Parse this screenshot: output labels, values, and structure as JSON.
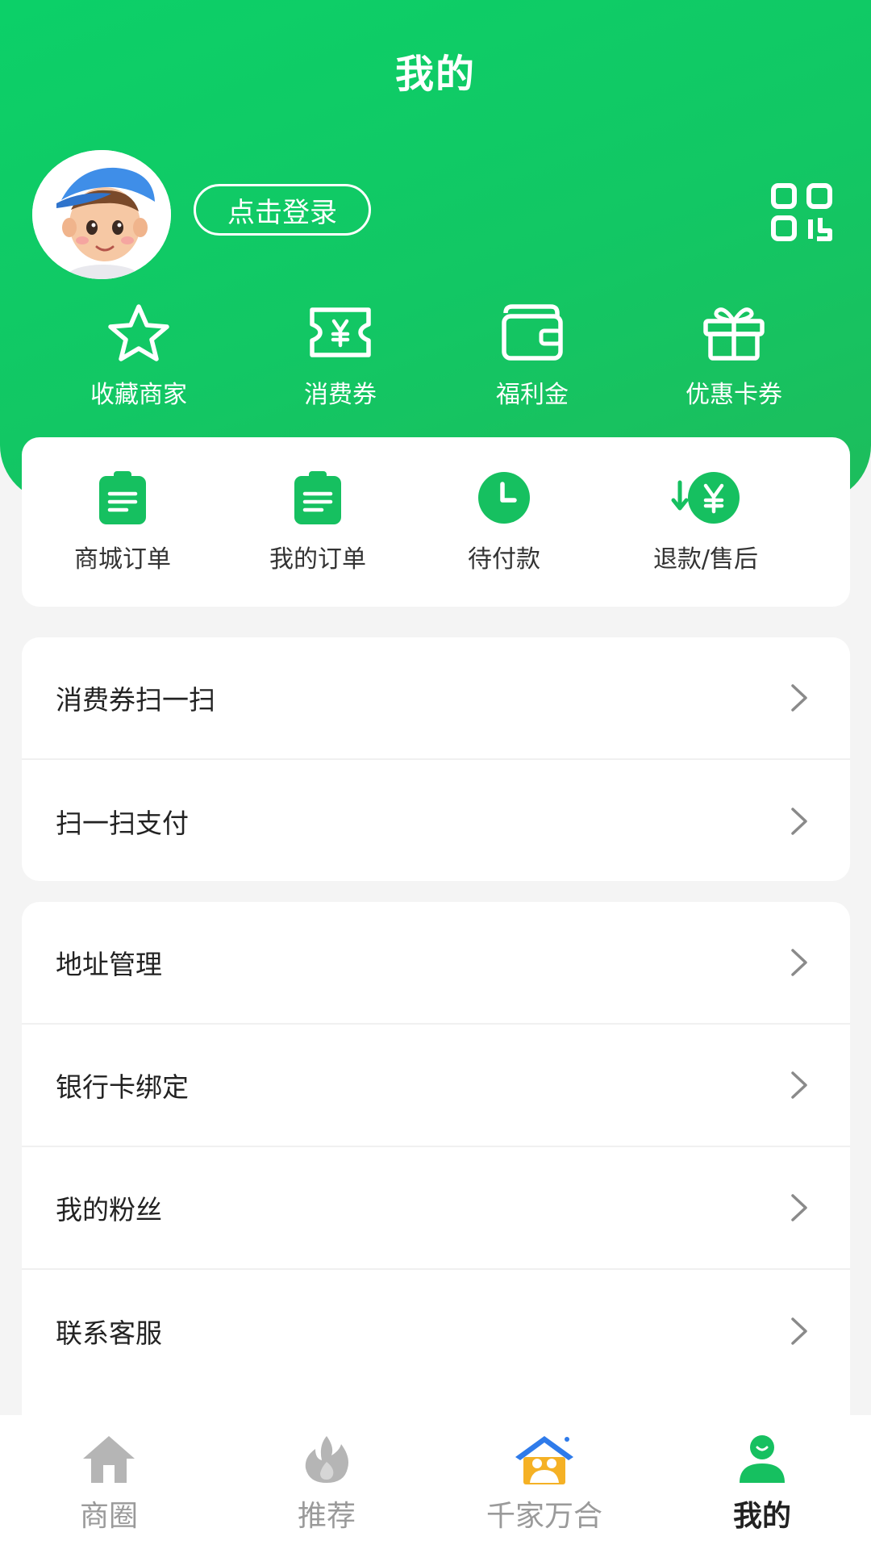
{
  "header": {
    "title": "我的",
    "login_label": "点击登录",
    "accent": "#12c764"
  },
  "quick_links": [
    {
      "label": "收藏商家",
      "icon": "star-icon"
    },
    {
      "label": "消费券",
      "icon": "ticket-icon"
    },
    {
      "label": "福利金",
      "icon": "wallet-icon"
    },
    {
      "label": "优惠卡券",
      "icon": "gift-icon"
    }
  ],
  "orders": [
    {
      "label": "商城订单",
      "icon": "order-doc-icon"
    },
    {
      "label": "我的订单",
      "icon": "order-doc-icon"
    },
    {
      "label": "待付款",
      "icon": "clock-icon"
    },
    {
      "label": "退款/售后",
      "icon": "refund-icon"
    }
  ],
  "menu_group_1": [
    {
      "label": "消费券扫一扫"
    },
    {
      "label": "扫一扫支付"
    }
  ],
  "menu_group_2": [
    {
      "label": "地址管理"
    },
    {
      "label": "银行卡绑定"
    },
    {
      "label": "我的粉丝"
    },
    {
      "label": "联系客服"
    }
  ],
  "tabbar": [
    {
      "label": "商圈",
      "icon": "home-icon",
      "active": false
    },
    {
      "label": "推荐",
      "icon": "flame-icon",
      "active": false
    },
    {
      "label": "千家万合",
      "icon": "house-family-icon",
      "active": false
    },
    {
      "label": "我的",
      "icon": "user-icon",
      "active": true
    }
  ]
}
